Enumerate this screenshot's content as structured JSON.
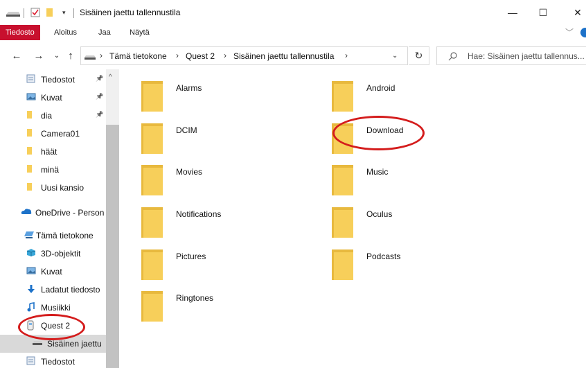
{
  "window": {
    "title": "Sisäinen jaettu tallennustila",
    "controls": {
      "minimize": "—",
      "maximize": "☐",
      "close": "✕"
    }
  },
  "ribbon": {
    "tabs": [
      "Tiedosto",
      "Aloitus",
      "Jaa",
      "Näytä"
    ]
  },
  "address": {
    "crumbs": [
      "Tämä tietokone",
      "Quest 2",
      "Sisäinen jaettu tallennustila"
    ],
    "search_placeholder": "Hae: Sisäinen jaettu tallennus..."
  },
  "nav": {
    "items": [
      {
        "label": "Tiedostot",
        "icon": "documents-icon",
        "pinned": true
      },
      {
        "label": "Kuvat",
        "icon": "pictures-icon",
        "pinned": true
      },
      {
        "label": "dia",
        "icon": "folder-icon",
        "pinned": true
      },
      {
        "label": "Camera01",
        "icon": "folder-icon"
      },
      {
        "label": "häät",
        "icon": "folder-icon"
      },
      {
        "label": "minä",
        "icon": "folder-icon"
      },
      {
        "label": "Uusi kansio",
        "icon": "folder-icon"
      },
      {
        "label": "OneDrive - Person",
        "icon": "onedrive-icon"
      },
      {
        "label": "Tämä tietokone",
        "icon": "computer-icon"
      },
      {
        "label": "3D-objektit",
        "icon": "3d-objects-icon"
      },
      {
        "label": "Kuvat",
        "icon": "pictures-icon"
      },
      {
        "label": "Ladatut tiedosto",
        "icon": "download-icon"
      },
      {
        "label": "Musiikki",
        "icon": "music-icon"
      },
      {
        "label": "Quest 2",
        "icon": "device-icon"
      },
      {
        "label": "Sisäinen jaettu",
        "icon": "drive-icon",
        "selected": true
      },
      {
        "label": "Tiedostot",
        "icon": "documents-icon"
      }
    ]
  },
  "folders": [
    "Alarms",
    "Android",
    "DCIM",
    "Download",
    "Movies",
    "Music",
    "Notifications",
    "Oculus",
    "Pictures",
    "Podcasts",
    "Ringtones"
  ],
  "colors": {
    "accent_red": "#c8102e",
    "annotation_red": "#d41c1c",
    "folder_yellow": "#f7cf5a",
    "selection_gray": "#d9d9d9"
  }
}
